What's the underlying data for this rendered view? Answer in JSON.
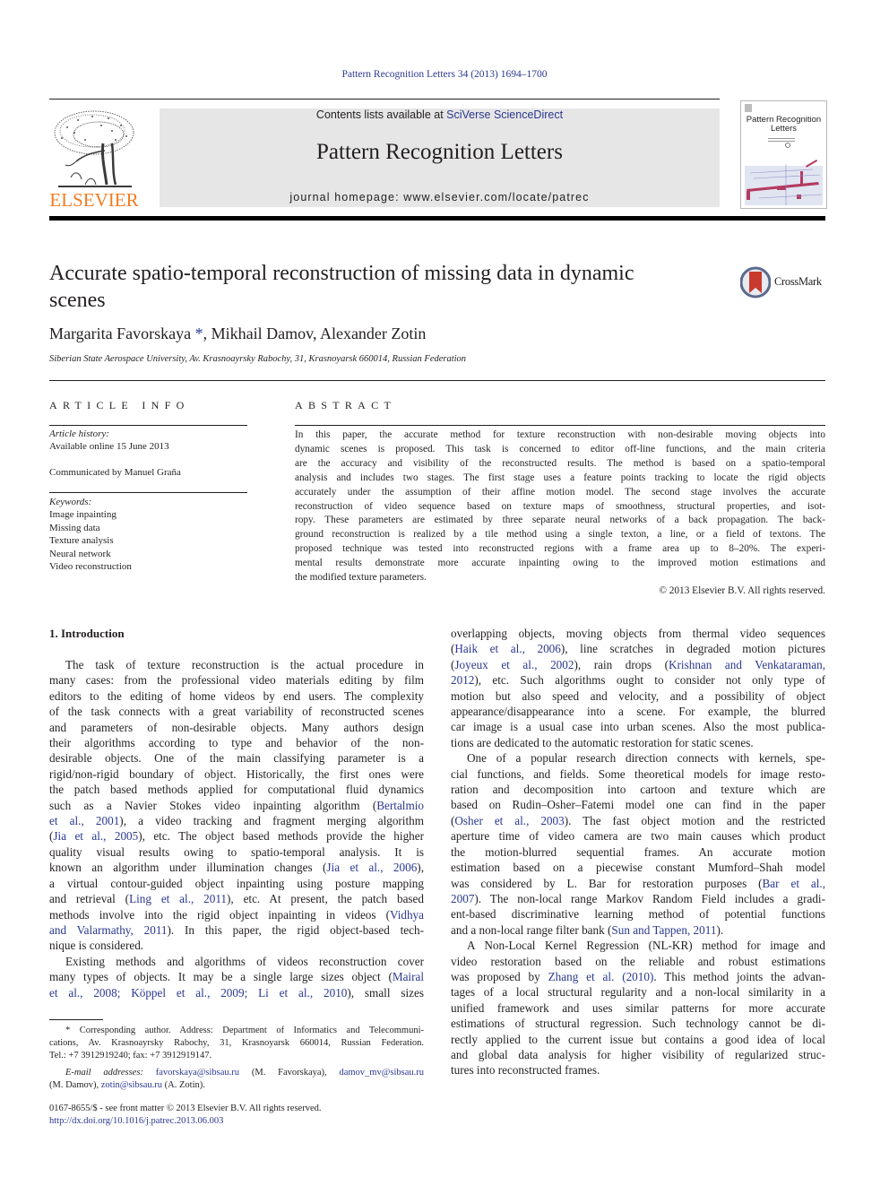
{
  "header": {
    "running_head": "Pattern Recognition Letters 34 (2013) 1694–1700",
    "publisher_logo_text": "ELSEVIER",
    "contents_prefix": "Contents lists available at ",
    "contents_link": "SciVerse ScienceDirect",
    "journal_title": "Pattern Recognition Letters",
    "journal_homepage": "journal homepage: www.elsevier.com/locate/patrec",
    "cover_title_line1": "Pattern Recognition",
    "cover_title_line2": "Letters",
    "icons": [
      "elsevier-tree-icon",
      "journal-cover-thumbnail",
      "crossmark-icon"
    ]
  },
  "article": {
    "title_line1": "Accurate spatio-temporal reconstruction of missing data in dynamic",
    "title_line2": "scenes",
    "crossmark_label": "CrossMark",
    "authors_prefix": "Margarita Favorskaya ",
    "author_mark": "*",
    "authors_rest": ", Mikhail Damov, Alexander Zotin",
    "affiliation": "Siberian State Aerospace University, Av. Krasnoayrsky Rabochy, 31, Krasnoyarsk 660014, Russian Federation"
  },
  "article_info": {
    "heading": "ARTICLE INFO",
    "history_label": "Article history:",
    "history_online": "Available online 15 June 2013",
    "communicated": "Communicated by Manuel Graña",
    "keywords_label": "Keywords:",
    "keywords": [
      "Image inpainting",
      "Missing data",
      "Texture analysis",
      "Neural network",
      "Video reconstruction"
    ]
  },
  "abstract": {
    "heading": "ABSTRACT",
    "lines": [
      "In this paper, the accurate method for texture reconstruction with non-desirable moving objects into",
      "dynamic scenes is proposed. This task is concerned to editor off-line functions, and the main criteria",
      "are the accuracy and visibility of the reconstructed results. The method is based on a spatio-temporal",
      "analysis and includes two stages. The first stage uses a feature points tracking to locate the rigid objects",
      "accurately under the assumption of their affine motion model. The second stage involves the accurate",
      "reconstruction of video sequence based on texture maps of smoothness, structural properties, and isot-",
      "ropy. These parameters are estimated by three separate neural networks of a back propagation. The back-",
      "ground reconstruction is realized by a tile method using a single texton, a line, or a field of textons. The",
      "proposed technique was tested into reconstructed regions with a frame area up to 8–20%. The experi-",
      "mental results demonstrate more accurate inpainting owing to the improved motion estimations and",
      "the modified texture parameters."
    ],
    "copyright": "© 2013 Elsevier B.V. All rights reserved."
  },
  "body": {
    "section_heading": "1. Introduction",
    "left_para1": [
      [
        {
          "t": "The task of texture reconstruction is the actual procedure in"
        }
      ],
      [
        {
          "t": "many cases: from the professional video materials editing by film"
        }
      ],
      [
        {
          "t": "editors to the editing of home videos by end users. The complexity"
        }
      ],
      [
        {
          "t": "of the task connects with a great variability of reconstructed scenes"
        }
      ],
      [
        {
          "t": "and parameters of non-desirable objects. Many authors design"
        }
      ],
      [
        {
          "t": "their algorithms according to type and behavior of the non-"
        }
      ],
      [
        {
          "t": "desirable objects. One of the main classifying parameter is a"
        }
      ],
      [
        {
          "t": "rigid/non-rigid boundary of object. Historically, the first ones were"
        }
      ],
      [
        {
          "t": "the patch based methods applied for computational fluid dynamics"
        }
      ],
      [
        {
          "t": "such as a Navier Stokes video inpainting algorithm ("
        },
        {
          "t": "Bertalmio",
          "link": true
        }
      ],
      [
        {
          "t": "et al., 2001",
          "link": true
        },
        {
          "t": "), a video tracking and fragment merging algorithm"
        }
      ],
      [
        {
          "t": "("
        },
        {
          "t": "Jia et al., 2005",
          "link": true
        },
        {
          "t": "), etc. The object based methods provide the higher"
        }
      ],
      [
        {
          "t": "quality visual results owing to spatio-temporal analysis. It is"
        }
      ],
      [
        {
          "t": "known an algorithm under illumination changes ("
        },
        {
          "t": "Jia et al., 2006",
          "link": true
        },
        {
          "t": "),"
        }
      ],
      [
        {
          "t": "a virtual contour-guided object inpainting using posture mapping"
        }
      ],
      [
        {
          "t": "and retrieval ("
        },
        {
          "t": "Ling et al., 2011",
          "link": true
        },
        {
          "t": "), etc. At present, the patch based"
        }
      ],
      [
        {
          "t": "methods involve into the rigid object inpainting in videos ("
        },
        {
          "t": "Vidhya",
          "link": true
        }
      ],
      [
        {
          "t": "and Valarmathy, 2011",
          "link": true
        },
        {
          "t": "). In this paper, the rigid object-based tech-"
        }
      ],
      [
        {
          "t": "nique is considered."
        }
      ]
    ],
    "left_para2": [
      [
        {
          "t": "Existing methods and algorithms of videos reconstruction cover"
        }
      ],
      [
        {
          "t": "many types of objects. It may be a single large sizes object ("
        },
        {
          "t": "Mairal",
          "link": true
        }
      ],
      [
        {
          "t": "et al., 2008; Köppel et al., 2009; Li et al., 2010",
          "link": true
        },
        {
          "t": "), small sizes"
        }
      ]
    ],
    "right_para1": [
      [
        {
          "t": "overlapping objects, moving objects from thermal video sequences"
        }
      ],
      [
        {
          "t": "("
        },
        {
          "t": "Haik et al., 2006",
          "link": true
        },
        {
          "t": "), line scratches in degraded motion pictures"
        }
      ],
      [
        {
          "t": "("
        },
        {
          "t": "Joyeux et al., 2002",
          "link": true
        },
        {
          "t": "), rain drops ("
        },
        {
          "t": "Krishnan and Venkataraman,",
          "link": true
        }
      ],
      [
        {
          "t": "2012",
          "link": true
        },
        {
          "t": "), etc. Such algorithms ought to consider not only type of"
        }
      ],
      [
        {
          "t": "motion but also speed and velocity, and a possibility of object"
        }
      ],
      [
        {
          "t": "appearance/disappearance into a scene. For example, the blurred"
        }
      ],
      [
        {
          "t": "car image is a usual case into urban scenes. Also the most publica-"
        }
      ],
      [
        {
          "t": "tions are dedicated to the automatic restoration for static scenes."
        }
      ]
    ],
    "right_para2": [
      [
        {
          "t": "One of a popular research direction connects with kernels, spe-"
        }
      ],
      [
        {
          "t": "cial functions, and fields. Some theoretical models for image resto-"
        }
      ],
      [
        {
          "t": "ration and decomposition into cartoon and texture which are"
        }
      ],
      [
        {
          "t": "based on Rudin–Osher–Fatemi model one can find in the paper"
        }
      ],
      [
        {
          "t": "("
        },
        {
          "t": "Osher et al., 2003",
          "link": true
        },
        {
          "t": "). The fast object motion and the restricted"
        }
      ],
      [
        {
          "t": "aperture time of video camera are two main causes which product"
        }
      ],
      [
        {
          "t": "the motion-blurred sequential frames. An accurate motion"
        }
      ],
      [
        {
          "t": "estimation based on a piecewise constant Mumford–Shah model"
        }
      ],
      [
        {
          "t": "was considered by L. Bar for restoration purposes ("
        },
        {
          "t": "Bar et al.,",
          "link": true
        }
      ],
      [
        {
          "t": "2007",
          "link": true
        },
        {
          "t": "). The non-local range Markov Random Field includes a gradi-"
        }
      ],
      [
        {
          "t": "ent-based discriminative learning method of potential functions"
        }
      ],
      [
        {
          "t": "and a non-local range filter bank ("
        },
        {
          "t": "Sun and Tappen, 2011",
          "link": true
        },
        {
          "t": ")."
        }
      ]
    ],
    "right_para3": [
      [
        {
          "t": "A Non-Local Kernel Regression (NL-KR) method for image and"
        }
      ],
      [
        {
          "t": "video restoration based on the reliable and robust estimations"
        }
      ],
      [
        {
          "t": "was proposed by "
        },
        {
          "t": "Zhang et al. (2010)",
          "link": true
        },
        {
          "t": ". This method joints the advan-"
        }
      ],
      [
        {
          "t": "tages of a local structural regularity and a non-local similarity in a"
        }
      ],
      [
        {
          "t": "unified framework and uses similar patterns for more accurate"
        }
      ],
      [
        {
          "t": "estimations of structural regression. Such technology cannot be di-"
        }
      ],
      [
        {
          "t": "rectly applied to the current issue but contains a good idea of local"
        }
      ],
      [
        {
          "t": "and global data analysis for higher visibility of regularized struc-"
        }
      ],
      [
        {
          "t": "tures into reconstructed frames."
        }
      ]
    ]
  },
  "footnote": {
    "lines": [
      [
        {
          "t": "* Corresponding author. Address: Department of Informatics and Telecommuni-"
        }
      ],
      [
        {
          "t": "cations, Av. Krasnoayrsky Rabochy, 31, Krasnoyarsk 660014, Russian Federation."
        }
      ],
      [
        {
          "t": "Tel.: +7 3912919240; fax: +7 3912919147."
        }
      ],
      [
        {
          "t": "E-mail addresses: ",
          "italic": true
        },
        {
          "t": "favorskaya@sibsau.ru",
          "link": true
        },
        {
          "t": " (M. Favorskaya), "
        },
        {
          "t": "damov_mv@sibsau.ru",
          "link": true
        }
      ],
      [
        {
          "t": "(M. Damov), "
        },
        {
          "t": "zotin@sibsau.ru",
          "link": true
        },
        {
          "t": " (A. Zotin)."
        }
      ]
    ]
  },
  "front_matter": {
    "issn_line": "0167-8655/$ - see front matter © 2013 Elsevier B.V. All rights reserved.",
    "doi": "http://dx.doi.org/10.1016/j.patrec.2013.06.003"
  }
}
